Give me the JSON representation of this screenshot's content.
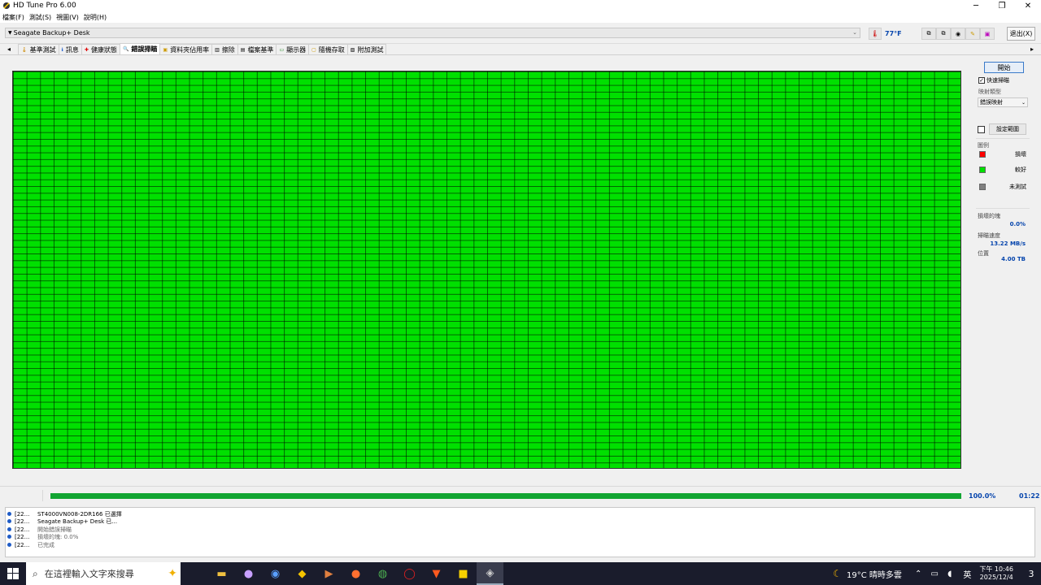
{
  "window": {
    "title": "HD Tune Pro 6.00",
    "minimize": "─",
    "maximize": "❐",
    "close": "✕"
  },
  "menu": [
    "檔案(F)",
    "測試(S)",
    "視圖(V)",
    "說明(H)"
  ],
  "toolbar": {
    "drive": "Seagate Backup+  Desk",
    "temperature": "77°F",
    "exit_label": "退出(X)"
  },
  "tabs": [
    {
      "label": "基準測試",
      "icon": "benchmark-icon"
    },
    {
      "label": "訊息",
      "icon": "info-icon"
    },
    {
      "label": "健康狀態",
      "icon": "health-icon"
    },
    {
      "label": "錯誤掃瞄",
      "icon": "error-scan-icon",
      "active": true
    },
    {
      "label": "資料夾佔用率",
      "icon": "folder-usage-icon"
    },
    {
      "label": "擦除",
      "icon": "erase-icon"
    },
    {
      "label": "檔案基準",
      "icon": "file-benchmark-icon"
    },
    {
      "label": "顯示器",
      "icon": "monitor-icon"
    },
    {
      "label": "隨機存取",
      "icon": "random-access-icon"
    },
    {
      "label": "附加測試",
      "icon": "extra-tests-icon"
    }
  ],
  "side": {
    "start_label": "開始",
    "quick_scan_label": "快速掃瞄",
    "quick_scan_checked": true,
    "map_type_label": "映射類型",
    "map_type_value": "錯誤映射",
    "set_range_label": "設定範圍",
    "set_range_checked": false,
    "legend_title": "圖例",
    "legend": [
      {
        "label": "損壞",
        "color": "#ff0000"
      },
      {
        "label": "較好",
        "color": "#00e000"
      },
      {
        "label": "未測試",
        "color": "#808080"
      }
    ],
    "damaged_label": "損壞的塊",
    "damaged_value": "0.0%",
    "speed_label": "掃瞄速度",
    "speed_value": "13.22 MB/s",
    "position_label": "位置",
    "position_value": "4.00 TB"
  },
  "progress": {
    "percent_text": "100.0%",
    "fraction": 1.0,
    "time": "01:22"
  },
  "log": [
    {
      "time": "[22...",
      "msg": "ST4000VN008-2DR166 已選擇",
      "gray": false
    },
    {
      "time": "[22...",
      "msg": "Seagate Backup+  Desk 已...",
      "gray": false
    },
    {
      "time": "[22...",
      "msg": "開始錯誤掃瞄",
      "gray": true
    },
    {
      "time": "[22...",
      "msg": "損壞的塊: 0.0%",
      "gray": true
    },
    {
      "time": "[22...",
      "msg": "已完成",
      "gray": true
    }
  ],
  "taskbar": {
    "search_placeholder": "在這裡輸入文字來搜尋",
    "weather": "19°C 晴時多雲",
    "ime": "英",
    "time": "下午 10:46",
    "date": "2025/12/4",
    "notifications": "3"
  },
  "colors": {
    "scan_ok": "#00e000",
    "progress": "#12a532",
    "value_blue": "#0645ad"
  }
}
